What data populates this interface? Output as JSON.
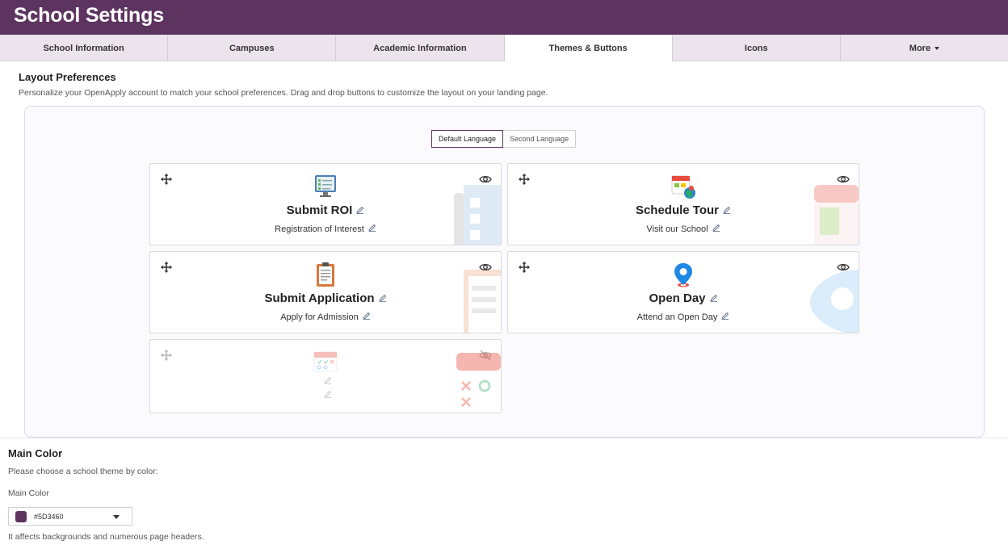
{
  "header": {
    "title": "School Settings",
    "brand_color": "#5D3460"
  },
  "tabs": [
    {
      "label": "School Information",
      "active": false
    },
    {
      "label": "Campuses",
      "active": false
    },
    {
      "label": "Academic Information",
      "active": false
    },
    {
      "label": "Themes & Buttons",
      "active": true
    },
    {
      "label": "Icons",
      "active": false
    },
    {
      "label": "More",
      "active": false
    }
  ],
  "layout": {
    "title": "Layout Preferences",
    "description": "Personalize your OpenApply account to match your school preferences. Drag and drop buttons to customize the layout on your landing page.",
    "languages": {
      "default": "Default Language",
      "second": "Second Language",
      "selected": "Default Language"
    },
    "cards": [
      {
        "title": "Submit ROI",
        "subtitle": "Registration of Interest",
        "icon": "checklist-icon",
        "visible": true
      },
      {
        "title": "Schedule Tour",
        "subtitle": "Visit our School",
        "icon": "calendar-globe-icon",
        "visible": true
      },
      {
        "title": "Submit Application",
        "subtitle": "Apply for Admission",
        "icon": "clipboard-icon",
        "visible": true
      },
      {
        "title": "Open Day",
        "subtitle": "Attend an Open Day",
        "icon": "location-pin-icon",
        "visible": true
      },
      {
        "title": "",
        "subtitle": "",
        "icon": "calendar-check-icon",
        "visible": false
      }
    ]
  },
  "main_color": {
    "title": "Main Color",
    "description": "Please choose a school theme by color:",
    "field_label": "Main Color",
    "value": "#5D3460",
    "note": "It affects backgrounds and numerous page headers."
  }
}
